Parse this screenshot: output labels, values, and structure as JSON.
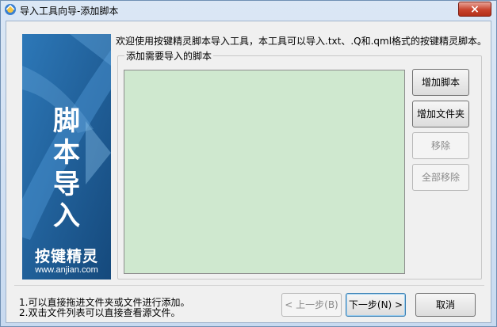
{
  "window": {
    "title": "导入工具向导-添加脚本",
    "close_glyph": "×"
  },
  "banner": {
    "title_chars": [
      "脚",
      "本",
      "导",
      "入"
    ],
    "brand": "按键精灵",
    "url": "www.anjian.com",
    "bg_color": "#1b5a92"
  },
  "intro_text": "欢迎使用按键精灵脚本导入工具，本工具可以导入.txt、.Q和.qml格式的按键精灵脚本。",
  "group": {
    "label": "添加需要导入的脚本",
    "list_bg": "#cfe8cf",
    "buttons": {
      "add_script": "增加脚本",
      "add_folder": "增加文件夹",
      "remove": "移除",
      "remove_all": "全部移除"
    }
  },
  "hints": [
    "1.可以直接拖进文件夹或文件进行添加。",
    "2.双击文件列表可以直接查看源文件。"
  ],
  "footer": {
    "back": "< 上一步(B)",
    "next": "下一步(N) >",
    "cancel": "取消"
  }
}
